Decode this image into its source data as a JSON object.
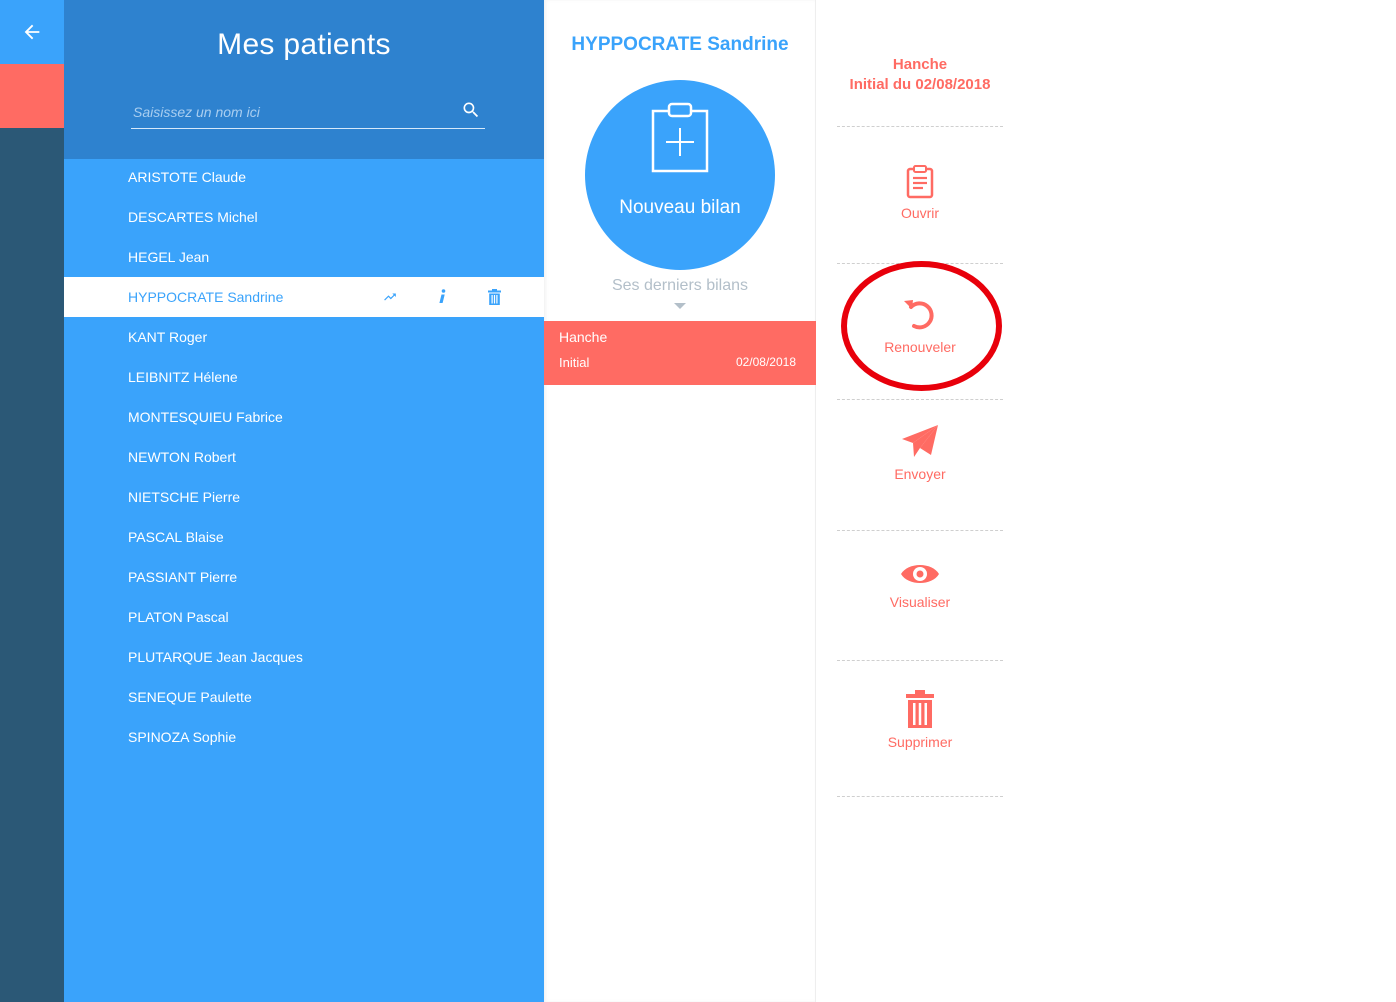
{
  "nav": {
    "back_icon": "arrow-left-icon"
  },
  "patients": {
    "title": "Mes patients",
    "search_placeholder": "Saisissez un nom ici",
    "list": [
      {
        "name": "ARISTOTE Claude"
      },
      {
        "name": "DESCARTES Michel"
      },
      {
        "name": "HEGEL Jean"
      },
      {
        "name": "HYPPOCRATE Sandrine",
        "selected": true
      },
      {
        "name": "KANT Roger"
      },
      {
        "name": "LEIBNITZ Hélene"
      },
      {
        "name": "MONTESQUIEU Fabrice"
      },
      {
        "name": "NEWTON Robert"
      },
      {
        "name": "NIETSCHE Pierre"
      },
      {
        "name": "PASCAL Blaise"
      },
      {
        "name": "PASSIANT Pierre"
      },
      {
        "name": "PLATON Pascal"
      },
      {
        "name": "PLUTARQUE Jean Jacques"
      },
      {
        "name": "SENEQUE Paulette"
      },
      {
        "name": "SPINOZA Sophie"
      }
    ],
    "row_action_icons": [
      "trending-up-icon",
      "info-icon",
      "trash-icon"
    ]
  },
  "detail": {
    "patient_name": "HYPPOCRATE Sandrine",
    "new_bilan_label": "Nouveau bilan",
    "last_bilans_label": "Ses derniers bilans",
    "bilans": [
      {
        "title": "Hanche",
        "type": "Initial",
        "date": "02/08/2018"
      }
    ]
  },
  "actions": {
    "header_line1": "Hanche",
    "header_line2": "Initial du 02/08/2018",
    "open": "Ouvrir",
    "renew": "Renouveler",
    "send": "Envoyer",
    "view": "Visualiser",
    "delete": "Supprimer"
  },
  "colors": {
    "primary": "#3aa3fb",
    "primary_dark": "#2e82cf",
    "accent": "#ff6b63",
    "rail": "#2b5876",
    "highlight": "#e8000b"
  }
}
